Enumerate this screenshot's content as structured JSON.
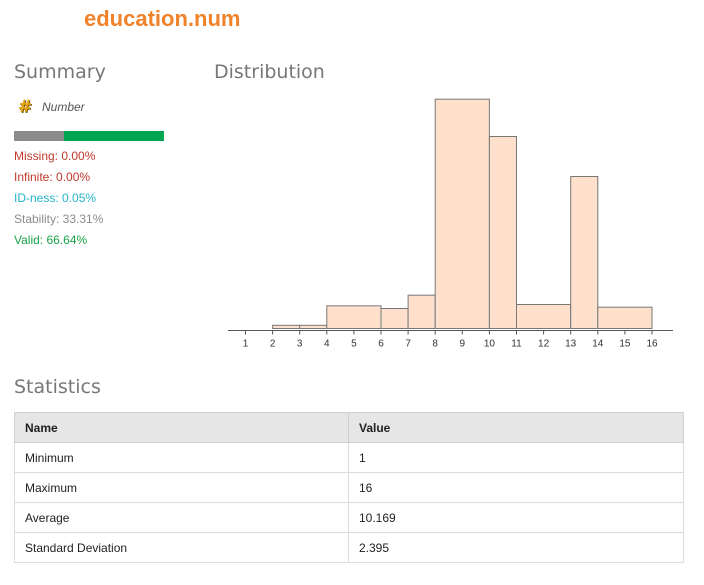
{
  "title": "education.num",
  "summary": {
    "heading": "Summary",
    "type_icon": "hash-icon",
    "type_label": "Number",
    "bar_colors": {
      "invalid": "#8c8c8c",
      "valid": "#00a651"
    },
    "bar_valid_fraction": 0.6664,
    "lines": [
      {
        "text": "Missing: 0.00%",
        "color": "#c0392b"
      },
      {
        "text": "Infinite: 0.00%",
        "color": "#c0392b"
      },
      {
        "text": "ID-ness: 0.05%",
        "color": "#26b5c9"
      },
      {
        "text": "Stability: 33.31%",
        "color": "#8c8c8c"
      },
      {
        "text": "Valid: 66.64%",
        "color": "#1aa34a"
      }
    ]
  },
  "distribution": {
    "heading": "Distribution"
  },
  "chart_data": {
    "type": "bar",
    "categories": [
      "1",
      "2",
      "3",
      "4",
      "5",
      "6",
      "7",
      "8",
      "9",
      "10",
      "11",
      "12",
      "13",
      "14",
      "15",
      "16"
    ],
    "bins": [
      {
        "from": "2",
        "to": "3",
        "value": 1.2
      },
      {
        "from": "3",
        "to": "4",
        "value": 1.2
      },
      {
        "from": "4",
        "to": "6",
        "value": 8.5
      },
      {
        "from": "6",
        "to": "7",
        "value": 7.5
      },
      {
        "from": "7",
        "to": "8",
        "value": 12.5
      },
      {
        "from": "8",
        "to": "10",
        "value": 86
      },
      {
        "from": "10",
        "to": "11",
        "value": 72
      },
      {
        "from": "11",
        "to": "13",
        "value": 9
      },
      {
        "from": "13",
        "to": "14",
        "value": 57
      },
      {
        "from": "14",
        "to": "16",
        "value": 8
      }
    ],
    "bar_fill": "#ffe0cc",
    "bar_stroke": "#777777",
    "ylim": [
      0,
      90
    ],
    "grid": false
  },
  "statistics": {
    "heading": "Statistics",
    "columns": [
      "Name",
      "Value"
    ],
    "rows": [
      [
        "Minimum",
        "1"
      ],
      [
        "Maximum",
        "16"
      ],
      [
        "Average",
        "10.169"
      ],
      [
        "Standard Deviation",
        "2.395"
      ]
    ]
  }
}
